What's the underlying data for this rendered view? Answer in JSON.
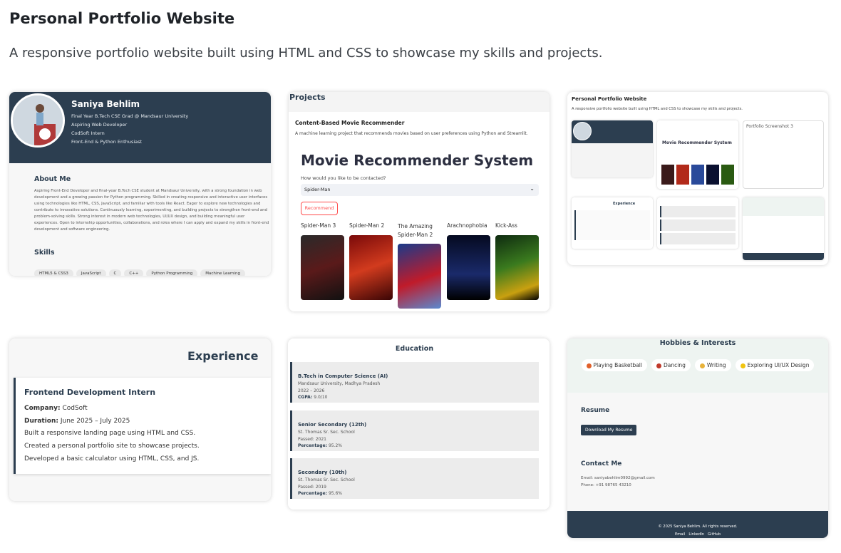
{
  "header": {
    "title": "Personal Portfolio Website",
    "subtitle": "A responsive portfolio website built using HTML and CSS to showcase my skills and projects."
  },
  "profile": {
    "name": "Saniya Behlim",
    "lines": [
      "Final Year B.Tech CSE Grad @ Mandsaur University",
      "Aspiring Web Developer",
      "CodSoft Intern",
      "Front-End & Python Enthusiast"
    ],
    "about_heading": "About Me",
    "about_text": "Aspiring Front-End Developer and final-year B.Tech CSE student at Mandsaur University, with a strong foundation in web development and a growing passion for Python programming. Skilled in creating responsive and interactive user interfaces using technologies like HTML, CSS, JavaScript, and familiar with tools like React. Eager to explore new technologies and contribute to innovative solutions. Continuously learning, experimenting, and building projects to strengthen front-end and problem-solving skills. Strong interest in modern web technologies, UI/UX design, and building meaningful user experiences. Open to internship opportunities, collaborations, and roles where I can apply and expand my skills in front-end development and software engineering.",
    "skills_heading": "Skills",
    "skills": [
      "HTML5 & CSS3",
      "JavaScript",
      "C",
      "C++",
      "Python Programming",
      "Machine Learning"
    ]
  },
  "projects": {
    "heading": "Projects",
    "project_title": "Content-Based Movie Recommender",
    "project_desc": "A machine learning project that recommends movies based on user preferences using Python and Streamlit.",
    "app_title": "Movie Recommender System",
    "select_label": "How would you like to be contacted?",
    "selected": "Spider-Man",
    "button": "Recommend",
    "movies": [
      "Spider-Man 3",
      "Spider-Man 2",
      "The Amazing Spider-Man 2",
      "Arachnophobia",
      "Kick-Ass"
    ]
  },
  "mini": {
    "title": "Personal Portfolio Website",
    "subtitle": "A responsive portfolio website built using HTML and CSS to showcase my skills and projects.",
    "broken_img_alt": "Portfolio Screenshot 3"
  },
  "experience": {
    "heading": "Experience",
    "role": "Frontend Development Intern",
    "company_label": "Company:",
    "company": "CodSoft",
    "duration_label": "Duration:",
    "duration": "June 2025 – July 2025",
    "items": [
      "Built a responsive landing page using HTML and CSS.",
      "Created a personal portfolio site to showcase projects.",
      "Developed a basic calculator using HTML, CSS, and JS."
    ]
  },
  "education": {
    "heading": "Education",
    "entries": [
      {
        "title": "B.Tech in Computer Science (AI)",
        "l1": "Mandsaur University, Madhya Pradesh",
        "l2": "2022 – 2026",
        "l3label": "CGPA:",
        "l3": "9.0/10"
      },
      {
        "title": "Senior Secondary (12th)",
        "l1": "St. Thomas Sr. Sec. School",
        "l2": "Passed: 2021",
        "l3label": "Percentage:",
        "l3": "95.2%"
      },
      {
        "title": "Secondary (10th)",
        "l1": "St. Thomas Sr. Sec. School",
        "l2": "Passed: 2019",
        "l3label": "Percentage:",
        "l3": "95.6%"
      }
    ]
  },
  "hobbies": {
    "heading": "Hobbies & Interests",
    "items": [
      "Playing Basketball",
      "Dancing",
      "Writing",
      "Exploring UI/UX Design"
    ],
    "resume_heading": "Resume",
    "resume_button": "Download My Resume",
    "contact_heading": "Contact Me",
    "email": "Email: saniyabehlim0992@gmail.com",
    "phone": "Phone: +91 98765 43210",
    "footer": "© 2025 Saniya Behlim. All rights reserved.",
    "links": [
      "Email",
      "LinkedIn",
      "GitHub"
    ]
  }
}
